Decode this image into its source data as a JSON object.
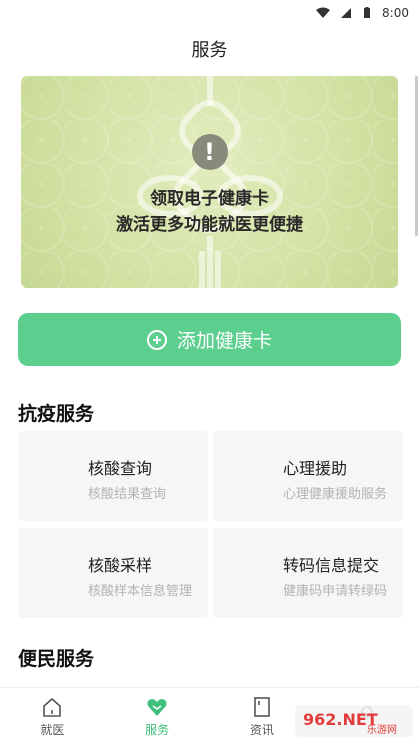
{
  "status_bar": {
    "time": "8:00"
  },
  "header": {
    "title": "服务"
  },
  "health_card": {
    "line1": "领取电子健康卡",
    "line2": "激活更多功能就医更便捷"
  },
  "add_card_button": {
    "label": "添加健康卡"
  },
  "sections": {
    "anti_epidemic": {
      "title": "抗疫服务",
      "tiles": [
        {
          "title": "核酸查询",
          "subtitle": "核酸结果查询"
        },
        {
          "title": "心理援助",
          "subtitle": "心理健康援助服务"
        },
        {
          "title": "核酸采样",
          "subtitle": "核酸样本信息管理"
        },
        {
          "title": "转码信息提交",
          "subtitle": "健康码申请转绿码"
        }
      ]
    },
    "convenience": {
      "title": "便民服务"
    }
  },
  "bottom_nav": {
    "items": [
      {
        "label": "就医",
        "icon": "home-icon"
      },
      {
        "label": "服务",
        "icon": "heart-icon",
        "active": true
      },
      {
        "label": "资讯",
        "icon": "document-icon"
      },
      {
        "label": "",
        "icon": "user-icon"
      }
    ]
  },
  "watermark": {
    "text": "962.NET",
    "subtext": "乐游网"
  },
  "colors": {
    "accent": "#5ccf8f",
    "active_nav": "#3fc07c",
    "card_bg": "#d4e3a6"
  }
}
